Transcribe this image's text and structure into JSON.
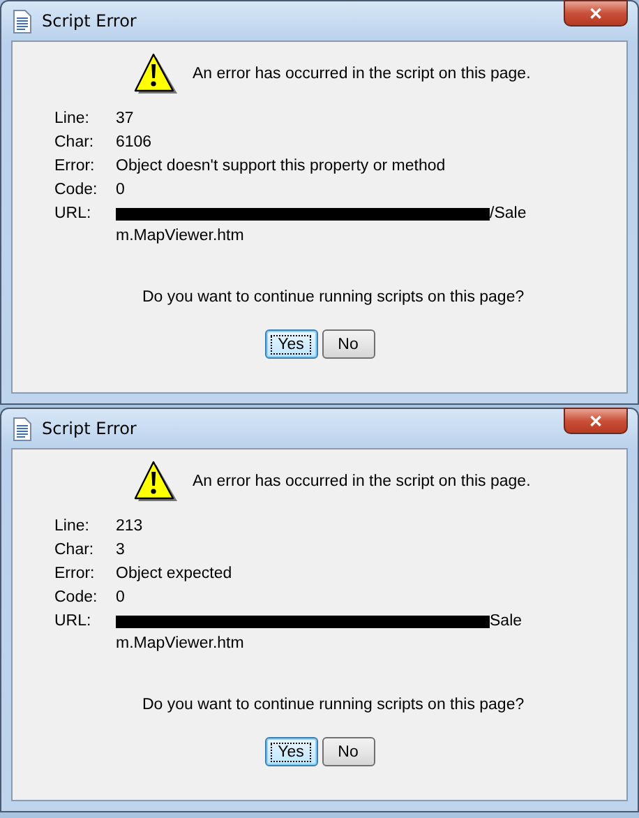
{
  "dialogs": [
    {
      "window": {
        "title": "Script Error",
        "close": "✕"
      },
      "message": "An error has occurred in the script on this page.",
      "fields": [
        {
          "label": "Line:",
          "value": "37"
        },
        {
          "label": "Char:",
          "value": "6106"
        },
        {
          "label": "Error:",
          "value": "Object doesn't support this property or method"
        },
        {
          "label": "Code:",
          "value": "0"
        }
      ],
      "url": {
        "label": "URL:",
        "redacted": true,
        "end": "/Sale",
        "line2": "m.MapViewer.htm"
      },
      "question": "Do you want to continue running scripts on this page?",
      "buttons": [
        {
          "label": "Yes",
          "selected": true
        },
        {
          "label": "No",
          "selected": false
        }
      ]
    },
    {
      "window": {
        "title": "Script Error",
        "close": "✕"
      },
      "message": "An error has occurred in the script on this page.",
      "fields": [
        {
          "label": "Line:",
          "value": "213"
        },
        {
          "label": "Char:",
          "value": "3"
        },
        {
          "label": "Error:",
          "value": "Object expected"
        },
        {
          "label": "Code:",
          "value": "0"
        }
      ],
      "url": {
        "label": "URL:",
        "redacted": true,
        "end": "Sale",
        "line2": "m.MapViewer.htm"
      },
      "question": "Do you want to continue running scripts on this page?",
      "buttons": [
        {
          "label": "Yes",
          "selected": true
        },
        {
          "label": "No",
          "selected": false
        }
      ]
    }
  ]
}
